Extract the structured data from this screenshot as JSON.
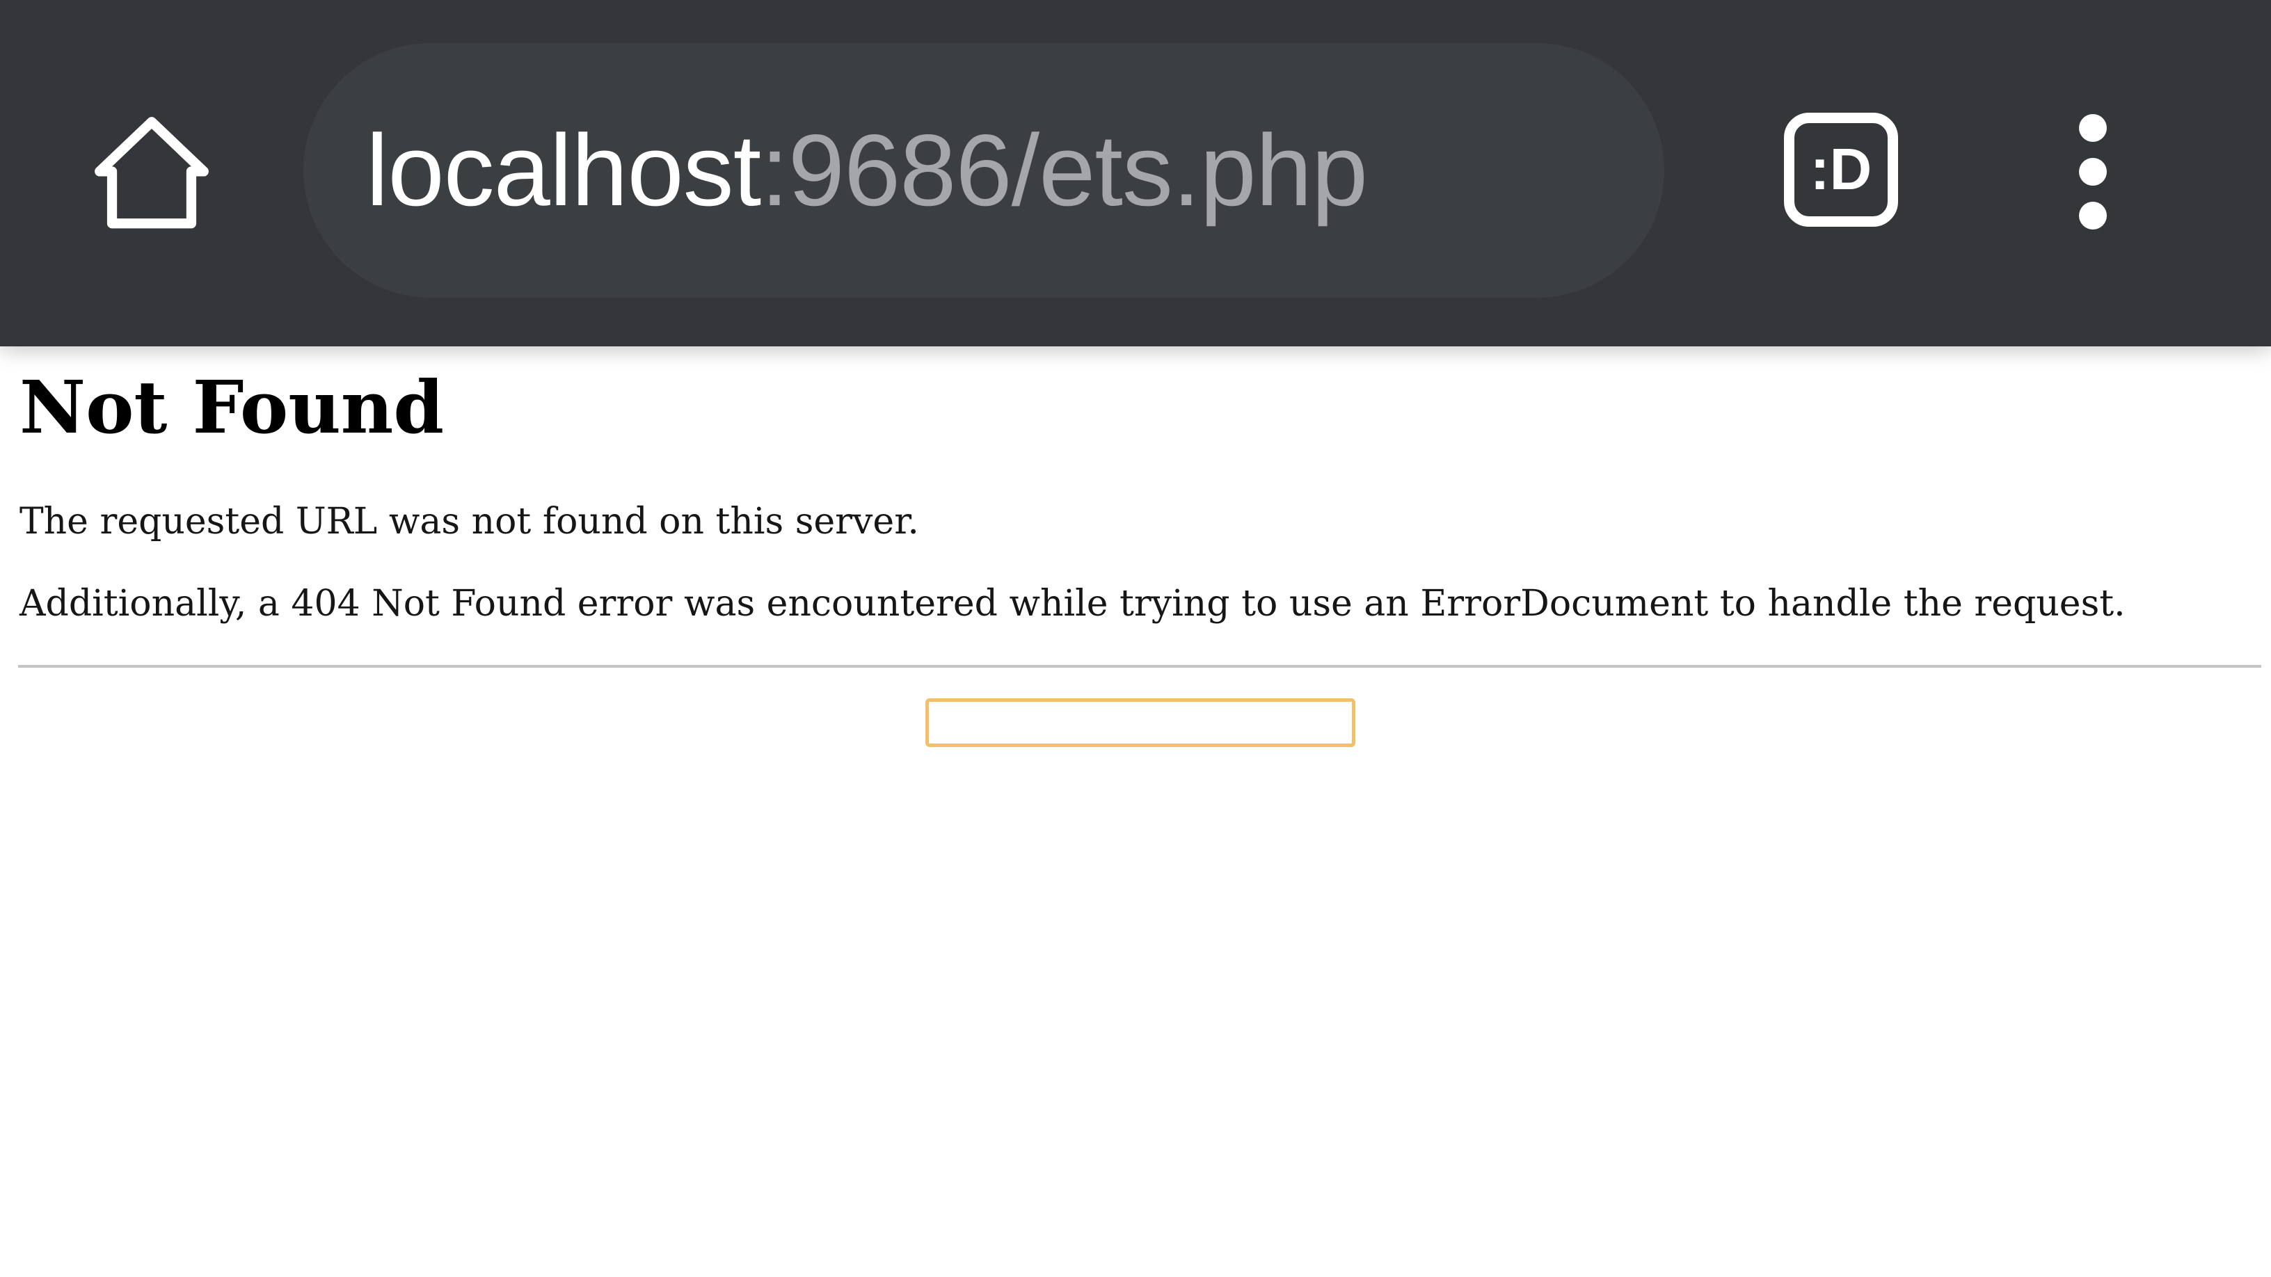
{
  "toolbar": {
    "home_icon": "home-icon",
    "url_host": "localhost",
    "url_path": ":9686/ets.php",
    "tab_switcher_label": ":D",
    "menu_icon": "more-vert-icon"
  },
  "page": {
    "title": "Not Found",
    "message": "The requested URL was not found on this server.",
    "detail": "Additionally, a 404 Not Found error was encountered while trying to use an ErrorDocument to handle the request.",
    "address_text": ""
  },
  "colors": {
    "toolbar_bg": "#35363a",
    "omnibox_bg": "#3c3f42",
    "url_host": "#ffffff",
    "url_path": "#a4a6a9",
    "address_box_border": "#f2c06a"
  }
}
